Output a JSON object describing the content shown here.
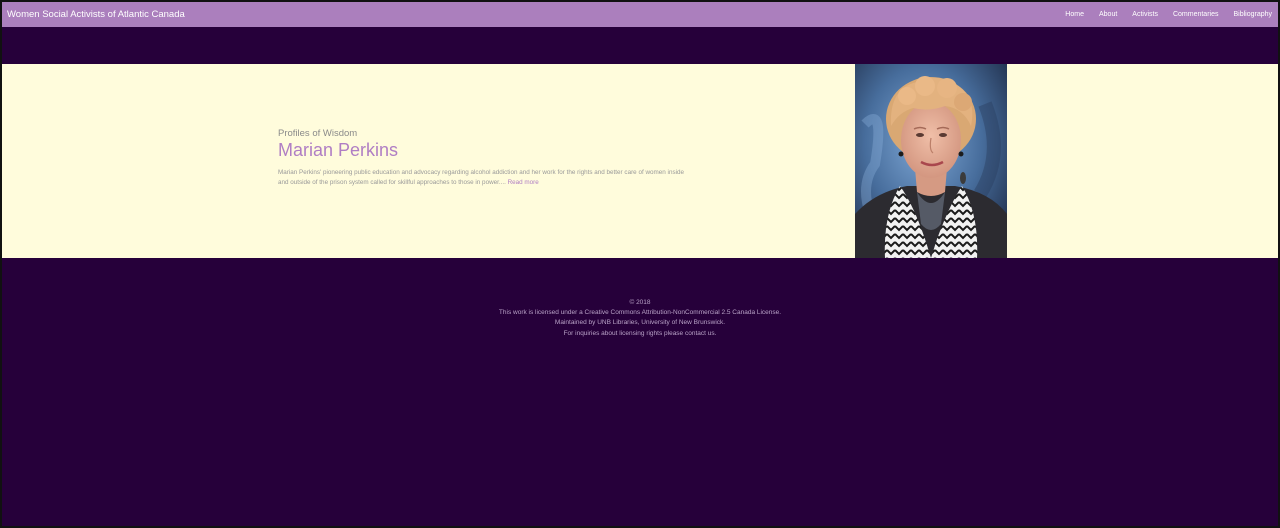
{
  "header": {
    "brand": "Women Social Activists of Atlantic Canada",
    "nav": [
      {
        "label": "Home"
      },
      {
        "label": "About"
      },
      {
        "label": "Activists"
      },
      {
        "label": "Commentaries"
      },
      {
        "label": "Bibliography"
      }
    ]
  },
  "hero": {
    "eyebrow": "Profiles of Wisdom",
    "title": "Marian Perkins",
    "summary": "Marian Perkins' pioneering public education and advocacy regarding alcohol addiction and her work for the rights and better care of women inside and outside of the prison system called for skillful approaches to those in power....",
    "read_more": "Read more"
  },
  "footer": {
    "copyright": "© 2018",
    "license": "This work is licensed under a Creative Commons Attribution-NonCommercial 2.5 Canada License.",
    "maintained": "Maintained by UNB Libraries, University of New Brunswick.",
    "inquiries": "For inquiries about licensing rights please contact us."
  },
  "colors": {
    "navbar": "#ab7fbd",
    "page_background": "#26003a",
    "hero_background": "#fffcdc",
    "accent": "#b07ec4"
  }
}
